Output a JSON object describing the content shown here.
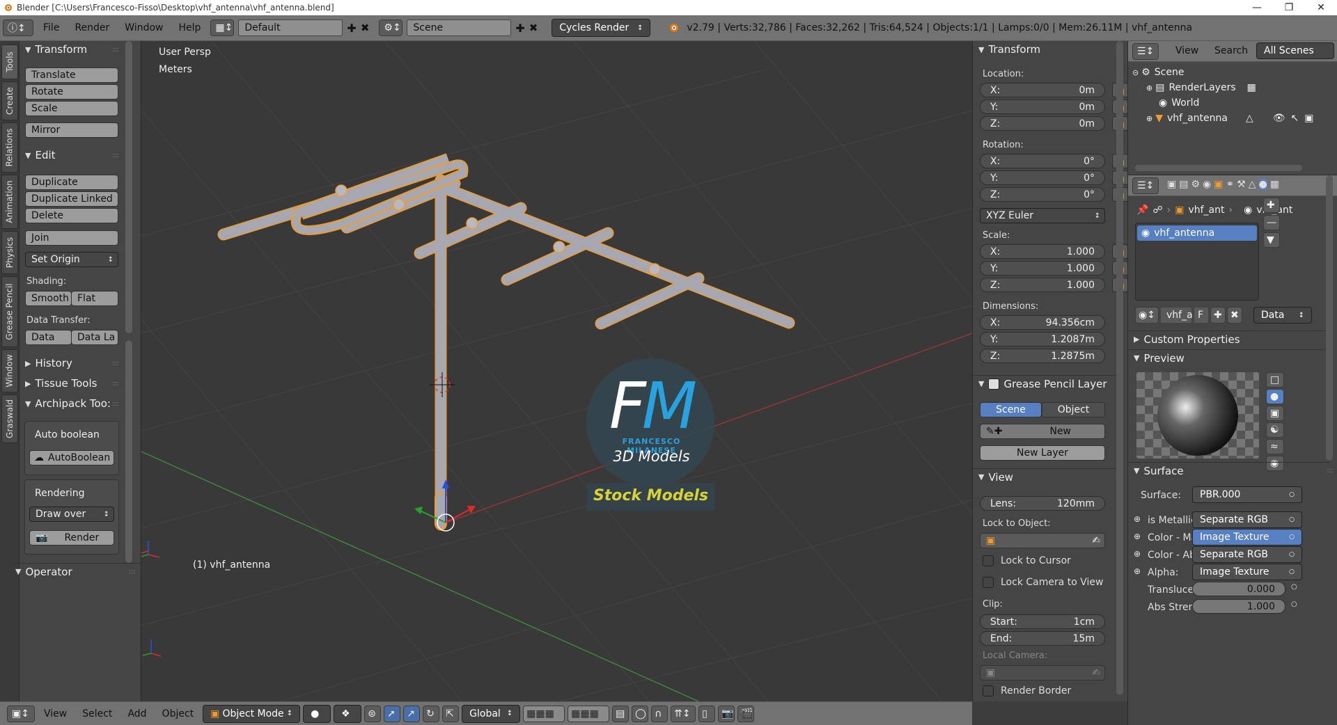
{
  "window": {
    "title": "Blender [C:\\Users\\Francesco-Fisso\\Desktop\\vhf_antenna\\vhf_antenna.blend]"
  },
  "topbar": {
    "menus": [
      "File",
      "Render",
      "Window",
      "Help"
    ],
    "layout": "Default",
    "scene": "Scene",
    "engine": "Cycles Render",
    "stats": "v2.79 | Verts:32,786 | Faces:32,262 | Tris:64,524 | Objects:1/1 | Lamps:0/0 | Mem:26.11M | vhf_antenna"
  },
  "left_tabs": [
    "Tools",
    "Create",
    "Relations",
    "Animation",
    "Physics",
    "Grease Pencil",
    "Window",
    "Graswald"
  ],
  "tools": {
    "transform_title": "Transform",
    "translate": "Translate",
    "rotate": "Rotate",
    "scale": "Scale",
    "mirror": "Mirror",
    "edit_title": "Edit",
    "duplicate": "Duplicate",
    "duplicate_linked": "Duplicate Linked",
    "delete": "Delete",
    "join": "Join",
    "set_origin": "Set Origin",
    "shading_label": "Shading:",
    "smooth": "Smooth",
    "flat": "Flat",
    "data_transfer_label": "Data Transfer:",
    "data": "Data",
    "data_la": "Data La",
    "history": "History",
    "tissue_tools": "Tissue Tools",
    "archipack_tools": "Archipack Too:",
    "auto_boolean_label": "Auto boolean",
    "auto_boolean_btn": "AutoBoolean",
    "rendering_label": "Rendering",
    "draw_over": "Draw over",
    "render": "Render",
    "operator": "Operator"
  },
  "viewport": {
    "view_name": "User Persp",
    "units": "Meters",
    "object_label": "(1) vhf_antenna",
    "watermark": {
      "initials": "FM",
      "name": "FRANCESCO MILANESE",
      "subtitle": "3D Models",
      "banner": "Stock Models"
    },
    "axis_x": "x",
    "axis_y": "y",
    "axis_z": "z"
  },
  "bottombar": {
    "menus": [
      "View",
      "Select",
      "Add",
      "Object"
    ],
    "mode": "Object Mode",
    "orientation": "Global"
  },
  "nprops": {
    "transform_title": "Transform",
    "location_label": "Location:",
    "loc_x": "X:",
    "loc_x_val": "0m",
    "loc_y": "Y:",
    "loc_y_val": "0m",
    "loc_z": "Z:",
    "loc_z_val": "0m",
    "rotation_label": "Rotation:",
    "rot_x": "X:",
    "rot_x_val": "0°",
    "rot_y": "Y:",
    "rot_y_val": "0°",
    "rot_z": "Z:",
    "rot_z_val": "0°",
    "rotation_mode": "XYZ Euler",
    "scale_label": "Scale:",
    "sc_x": "X:",
    "sc_x_val": "1.000",
    "sc_y": "Y:",
    "sc_y_val": "1.000",
    "sc_z": "Z:",
    "sc_z_val": "1.000",
    "dimensions_label": "Dimensions:",
    "dim_x": "X:",
    "dim_x_val": "94.356cm",
    "dim_y": "Y:",
    "dim_y_val": "1.2087m",
    "dim_z": "Z:",
    "dim_z_val": "1.2875m",
    "gp_title": "Grease Pencil Layer",
    "gp_scene": "Scene",
    "gp_object": "Object",
    "gp_new": "New",
    "gp_new_layer": "New Layer",
    "view_title": "View",
    "lens_label": "Lens:",
    "lens_val": "120mm",
    "lock_obj_label": "Lock to Object:",
    "lock_cursor": "Lock to Cursor",
    "lock_camera": "Lock Camera to View",
    "clip_label": "Clip:",
    "clip_start": "Start:",
    "clip_start_val": "1cm",
    "clip_end": "End:",
    "clip_end_val": "15m",
    "local_camera": "Local Camera:",
    "render_border": "Render Border"
  },
  "outliner": {
    "view": "View",
    "search": "Search",
    "all_scenes": "All Scenes",
    "scene": "Scene",
    "renderlayers": "RenderLayers",
    "world": "World",
    "object": "vhf_antenna"
  },
  "props": {
    "crumb_obj": "vhf_ant",
    "crumb_mat": "vhf_ant",
    "slot": "vhf_antenna",
    "mat_name": "vhf_a",
    "mat_f": "F",
    "link": "Data",
    "custom_properties": "Custom Properties",
    "preview": "Preview",
    "surface_title": "Surface",
    "surface_label": "Surface:",
    "surface_val": "PBR.000",
    "metallic_label": "is Metallic",
    "metallic_val": "Separate RGB",
    "color_ma_label": "Color - Ma",
    "color_ma_val": "Image Texture",
    "color_ab_label": "Color - Ab",
    "color_ab_val": "Separate RGB",
    "alpha_label": "Alpha:",
    "alpha_val": "Image Texture",
    "transl_label": "Transluce",
    "transl_val": "0.000",
    "abs_label": "Abs Stren",
    "abs_val": "1.000"
  },
  "colors": {
    "accent_blue": "#5680c2",
    "selected_outline": "#f19b2c",
    "watermark_blue": "#29a3e0",
    "banner_yellow": "#d8d237"
  }
}
